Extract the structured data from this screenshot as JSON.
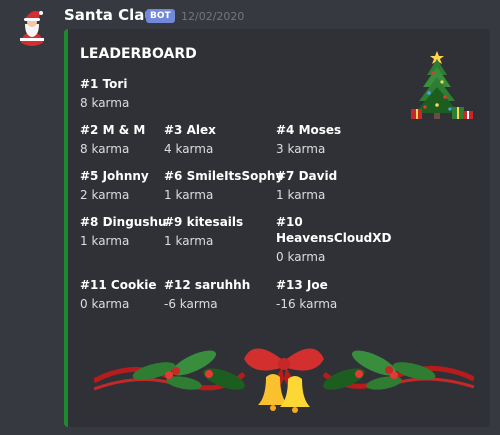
{
  "message": {
    "author": "Santa Claus",
    "bot_badge": "BOT",
    "timestamp": "12/02/2020",
    "avatar_icon": "santa-avatar-icon"
  },
  "embed": {
    "accent_color": "#1e8a2e",
    "title": "LEADERBOARD",
    "thumbnail_icon": "christmas-tree-icon",
    "image_icon": "christmas-garland-bells-icon",
    "fields": [
      {
        "name": "#1 Tori",
        "value": "8 karma"
      },
      {
        "name": "#2 M & M",
        "value": "8 karma"
      },
      {
        "name": "#3 Alex",
        "value": "4 karma"
      },
      {
        "name": "#4 Moses",
        "value": "3 karma"
      },
      {
        "name": "#5 Johnny",
        "value": "2 karma"
      },
      {
        "name": "#6 SmileItsSophy",
        "value": "1 karma"
      },
      {
        "name": "#7 David",
        "value": "1 karma"
      },
      {
        "name": "#8 Dingushu",
        "value": "1 karma"
      },
      {
        "name": "#9 kitesails",
        "value": "1 karma"
      },
      {
        "name": "#10",
        "name_line2": "HeavensCloudXD",
        "value": "0 karma"
      },
      {
        "name": "#11 Cookie",
        "value": "0 karma"
      },
      {
        "name": "#12 saruhhh",
        "value": "-6 karma"
      },
      {
        "name": "#13 Joe",
        "value": "-16 karma"
      }
    ]
  }
}
